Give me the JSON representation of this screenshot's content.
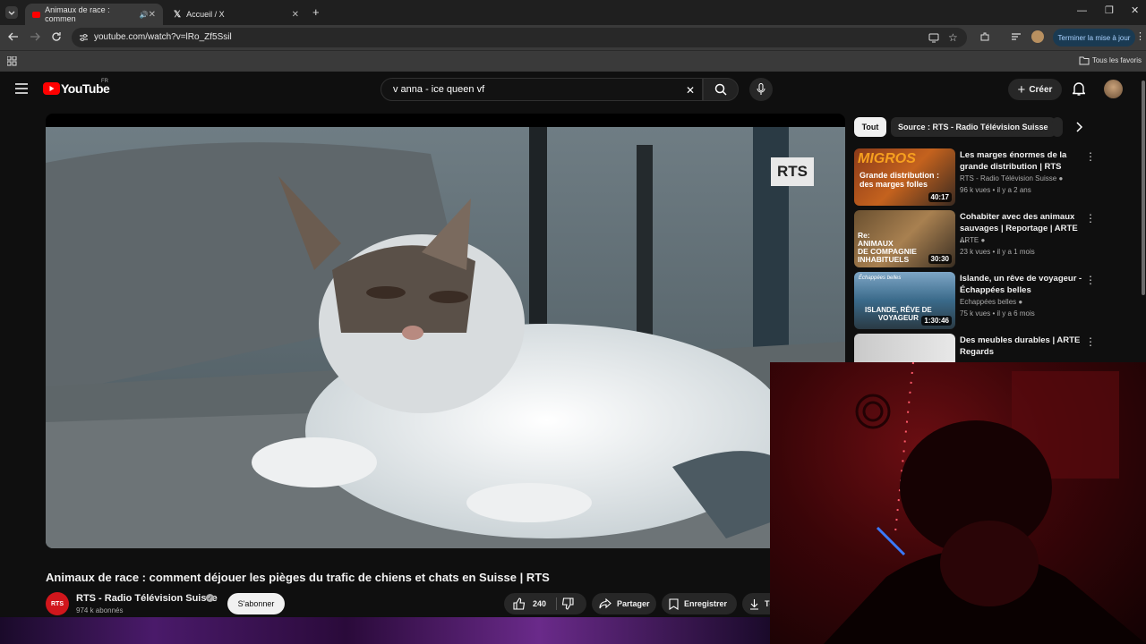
{
  "browser": {
    "tabs": [
      {
        "label": "Animaux de race : commen",
        "active": true
      },
      {
        "label": "Accueil / X",
        "active": false
      }
    ],
    "url": "youtube.com/watch?v=lRo_Zf5Ssil",
    "update_button": "Terminer la mise à jour",
    "bookmarks_label": "Tous les favoris"
  },
  "youtube": {
    "logo": "YouTube",
    "region": "FR",
    "search_value": "v anna - ice queen vf",
    "create_label": "Créer"
  },
  "video": {
    "watermark": "RTS",
    "title": "Animaux de race : comment déjouer les pièges du trafic de chiens et chats en Suisse | RTS",
    "channel_logo": "RTS",
    "channel": "RTS - Radio Télévision Suisse",
    "subscribers": "974 k abonnés",
    "subscribe_label": "S'abonner",
    "likes": "240",
    "share_label": "Partager",
    "save_label": "Enregistrer",
    "download_partial": "Té"
  },
  "sidebar": {
    "chips": [
      "Tout",
      "Source : RTS - Radio Télévision Suisse"
    ],
    "recommendations": [
      {
        "title": "Les marges énormes de la grande distribution | RTS",
        "channel": "RTS - Radio Télévision Suisse",
        "meta": "96 k vues • il y a 2 ans",
        "duration": "40:17",
        "thumb_text": [
          "MIGROS",
          "Grande distribution :",
          "des marges folles"
        ]
      },
      {
        "title": "Cohabiter avec des animaux sauvages | Reportage | ARTE ...",
        "channel": "ARTE",
        "meta": "23 k vues • il y a 1 mois",
        "duration": "30:30",
        "thumb_text": [
          "Re:",
          "ANIMAUX",
          "DE COMPAGNIE",
          "INHABITUELS"
        ]
      },
      {
        "title": "Islande, un rêve de voyageur - Échappées belles",
        "channel": "Echappées belles",
        "meta": "75 k vues • il y a 6 mois",
        "duration": "1:30:46",
        "thumb_text": [
          "Échappées belles",
          "ISLANDE, RÊVE DE",
          "VOYAGEUR"
        ]
      },
      {
        "title": "Des meubles durables | ARTE Regards",
        "channel": "",
        "meta": "",
        "duration": "",
        "thumb_text": []
      }
    ]
  },
  "colors": {
    "yt_red": "#ff0000",
    "rts_red": "#d1161c",
    "update_bg": "#1a3a52"
  }
}
